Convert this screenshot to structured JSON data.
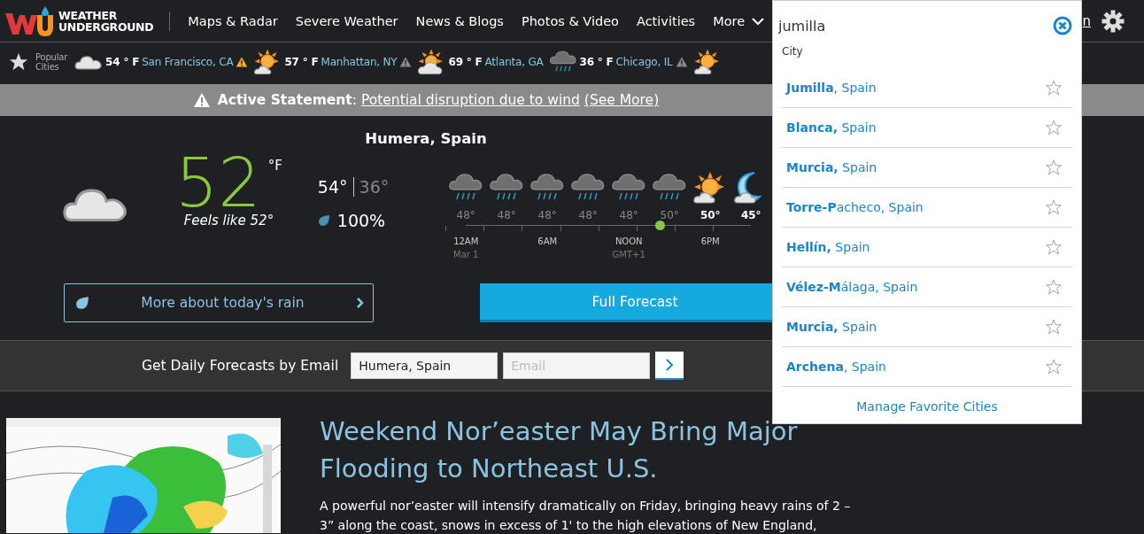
{
  "header": {
    "logo_lines": [
      "WEATHER",
      "UNDERGROUND"
    ],
    "nav": [
      {
        "label": "Maps & Radar"
      },
      {
        "label": "Severe Weather"
      },
      {
        "label": "News & Blogs"
      },
      {
        "label": "Photos & Video"
      },
      {
        "label": "Activities"
      },
      {
        "label": "More",
        "kind": "menu"
      }
    ],
    "account_link": "n"
  },
  "ticker": {
    "label_lines": [
      "Popular",
      "Cities"
    ],
    "cities": [
      {
        "kind": "cloud",
        "temp": "54 ° F",
        "city": "San Francisco, CA",
        "color": "#f8b01c"
      },
      {
        "kind": "sun-cloud",
        "temp": "57 ° F",
        "city": "Manhattan, NY",
        "color": "#8a8a8a"
      },
      {
        "kind": "cloud-sun",
        "temp": "69 ° F",
        "city": "Atlanta, GA"
      },
      {
        "kind": "rain",
        "temp": "36 ° F",
        "city": "Chicago, IL",
        "color": "#8a8a8a"
      },
      {
        "kind": "sun-cloud"
      }
    ]
  },
  "alert": {
    "title": "**Active Statement**:",
    "link": "Potential disruption due to wind",
    "more": "(See More)"
  },
  "current": {
    "location": "Humera, Spain",
    "kind": "cloud",
    "temp": "52",
    "unit": "°F",
    "feels_like": "Feels like 52°",
    "high": "54°",
    "low": "36°",
    "precip": "100%"
  },
  "hourly": [
    {
      "kind": "rain",
      "temp": "48°",
      "past": true,
      "now": false,
      "time": "12AM",
      "date": "Mar 1"
    },
    {
      "kind": "rain",
      "temp": "48°",
      "past": true,
      "now": false
    },
    {
      "kind": "rain",
      "temp": "48°",
      "past": true,
      "now": false,
      "time": "6AM"
    },
    {
      "kind": "rain",
      "temp": "48°",
      "past": true,
      "now": false
    },
    {
      "kind": "rain",
      "temp": "48°",
      "past": true,
      "now": false,
      "time": "NOON",
      "date": "GMT+1"
    },
    {
      "kind": "rain",
      "temp": "50°",
      "past": true,
      "now": true
    },
    {
      "kind": "sun-cloud",
      "temp": "50°",
      "past": false,
      "now": false,
      "time": "6PM"
    },
    {
      "kind": "moon-cloud",
      "temp": "45°",
      "past": false,
      "now": false
    }
  ],
  "actions": {
    "rain_button": "More about today's rain",
    "forecast_button": "Full Forecast"
  },
  "email_signup": {
    "label": "Get Daily Forecasts by Email",
    "location_value": "Humera, Spain",
    "email_placeholder": "Email"
  },
  "article": {
    "title": "Weekend Nor’easter May Bring Major Flooding to Northeast U.S.",
    "body": "A powerful nor’easter will intensify dramatically on Friday, bringing heavy rains of 2 – 3” along the coast, snows in excess of 1' to the high elevations of New England,"
  },
  "search_dropdown": {
    "query": "jumilla",
    "section": "City",
    "results": [
      {
        "name": "**Jumilla**, Spain",
        "favorite": false
      },
      {
        "name": "**Blanca,** Spain",
        "favorite": false
      },
      {
        "name": "**Murcia,** Spain",
        "favorite": false
      },
      {
        "name": "**Torre-P**acheco, Spain",
        "favorite": false
      },
      {
        "name": "**Hellín,** Spain",
        "favorite": false
      },
      {
        "name": "**Vélez-M**álaga, Spain",
        "favorite": false
      },
      {
        "name": "**Murcia,** Spain",
        "favorite": false
      },
      {
        "name": "**Archena**, Spain",
        "favorite": false
      }
    ],
    "footer_link": "Manage Favorite Cities"
  }
}
